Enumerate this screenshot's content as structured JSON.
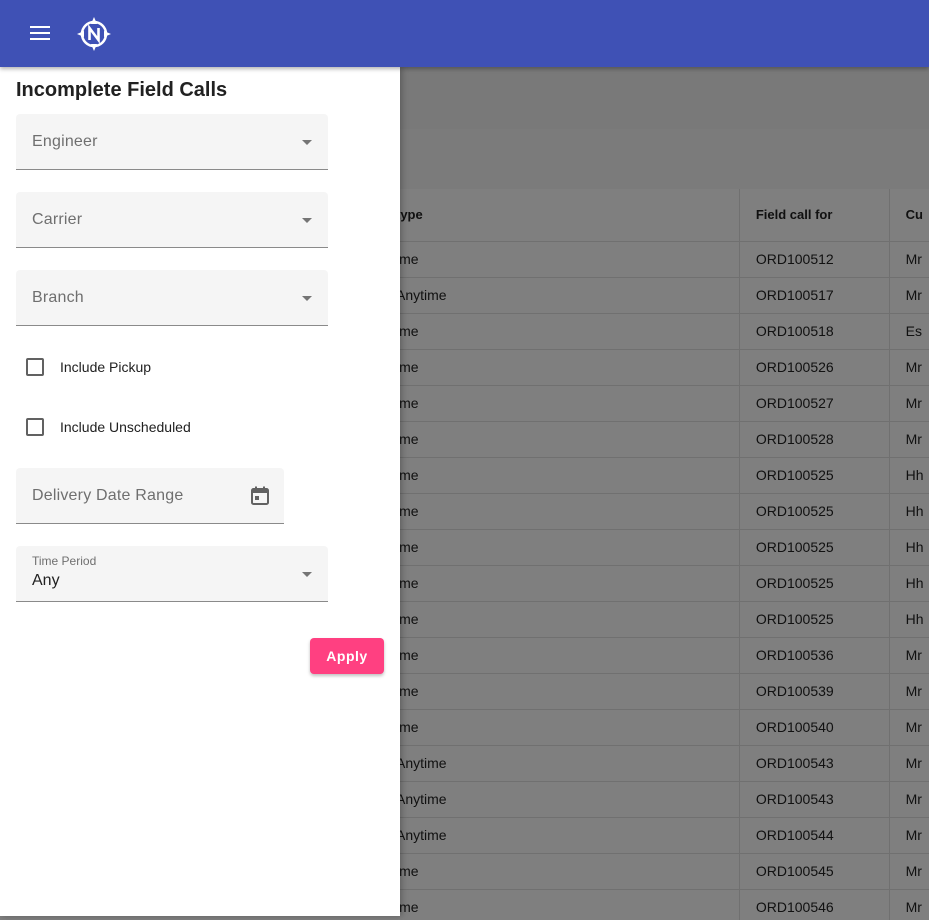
{
  "toolbar": {
    "menu_icon": "menu-icon",
    "logo_icon": "compass-n-logo-icon",
    "color": "#3f51b5"
  },
  "drawer": {
    "title": "Incomplete Field Calls",
    "engineer": {
      "placeholder": "Engineer"
    },
    "carrier": {
      "placeholder": "Carrier"
    },
    "branch": {
      "placeholder": "Branch"
    },
    "include_pickup": {
      "label": "Include Pickup",
      "checked": false
    },
    "include_unscheduled": {
      "label": "Include Unscheduled",
      "checked": false
    },
    "delivery_date_range": {
      "placeholder": "Delivery Date Range",
      "icon": "calendar-icon"
    },
    "time_period": {
      "label": "Time Period",
      "value": "Any"
    },
    "apply_label": "Apply",
    "accent": "#ff4081"
  },
  "table": {
    "headers": {
      "type": "type",
      "field_call_for": "Field call for",
      "customer": "Cu"
    },
    "rows": [
      {
        "type": "ime",
        "order": "ORD100512",
        "customer": "Mr"
      },
      {
        "type": "Anytime",
        "order": "ORD100517",
        "customer": "Mr"
      },
      {
        "type": "ime",
        "order": "ORD100518",
        "customer": "Es"
      },
      {
        "type": "ime",
        "order": "ORD100526",
        "customer": "Mr"
      },
      {
        "type": "ime",
        "order": "ORD100527",
        "customer": "Mr"
      },
      {
        "type": "ime",
        "order": "ORD100528",
        "customer": "Mr"
      },
      {
        "type": "ime",
        "order": "ORD100525",
        "customer": "Hh"
      },
      {
        "type": "ime",
        "order": "ORD100525",
        "customer": "Hh"
      },
      {
        "type": "ime",
        "order": "ORD100525",
        "customer": "Hh"
      },
      {
        "type": "ime",
        "order": "ORD100525",
        "customer": "Hh"
      },
      {
        "type": "ime",
        "order": "ORD100525",
        "customer": "Hh"
      },
      {
        "type": "ime",
        "order": "ORD100536",
        "customer": "Mr"
      },
      {
        "type": "ime",
        "order": "ORD100539",
        "customer": "Mr"
      },
      {
        "type": "ime",
        "order": "ORD100540",
        "customer": "Mr"
      },
      {
        "type": "Anytime",
        "order": "ORD100543",
        "customer": "Mr"
      },
      {
        "type": "Anytime",
        "order": "ORD100543",
        "customer": "Mr"
      },
      {
        "type": "Anytime",
        "order": "ORD100544",
        "customer": "Mr"
      },
      {
        "type": "ime",
        "order": "ORD100545",
        "customer": "Mr"
      },
      {
        "type": "ime",
        "order": "ORD100546",
        "customer": "Mr"
      }
    ]
  }
}
